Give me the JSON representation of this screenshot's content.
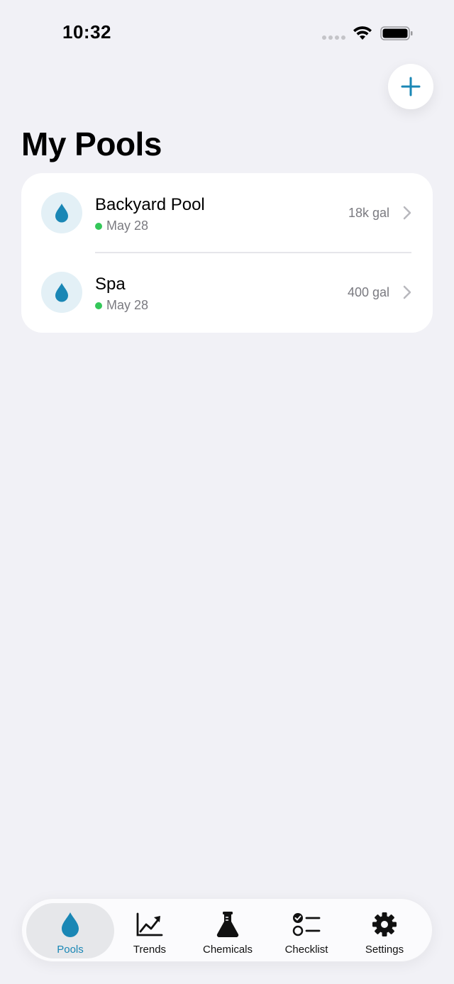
{
  "status_bar": {
    "time": "10:32"
  },
  "header": {
    "title": "My Pools",
    "add_button_icon": "plus-icon"
  },
  "pools": [
    {
      "name": "Backyard Pool",
      "date": "May 28",
      "volume": "18k gal",
      "icon": "water-drop-icon",
      "status_color": "#34c759"
    },
    {
      "name": "Spa",
      "date": "May 28",
      "volume": "400 gal",
      "icon": "water-drop-icon",
      "status_color": "#34c759"
    }
  ],
  "tabs": [
    {
      "label": "Pools",
      "icon": "water-drop-icon",
      "active": true
    },
    {
      "label": "Trends",
      "icon": "chart-line-icon",
      "active": false
    },
    {
      "label": "Chemicals",
      "icon": "flask-icon",
      "active": false
    },
    {
      "label": "Checklist",
      "icon": "checklist-icon",
      "active": false
    },
    {
      "label": "Settings",
      "icon": "gear-icon",
      "active": false
    }
  ],
  "colors": {
    "accent": "#1a87b5",
    "background": "#f1f1f6",
    "status_green": "#34c759"
  }
}
